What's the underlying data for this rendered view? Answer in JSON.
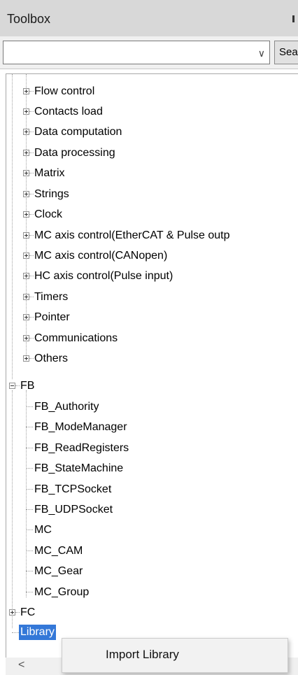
{
  "window": {
    "title": "Toolbox"
  },
  "search": {
    "value": "",
    "button_label": "Sea"
  },
  "tree": {
    "instruction_children": [
      "Flow control",
      "Contacts load",
      "Data computation",
      "Data processing",
      "Matrix",
      "Strings",
      "Clock",
      "MC axis control(EtherCAT & Pulse outp",
      "MC axis control(CANopen)",
      "HC axis control(Pulse input)",
      "Timers",
      "Pointer",
      "Communications",
      "Others"
    ],
    "fb": {
      "label": "FB",
      "children": [
        "FB_Authority",
        "FB_ModeManager",
        "FB_ReadRegisters",
        "FB_StateMachine",
        "FB_TCPSocket",
        "FB_UDPSocket",
        "MC",
        "MC_CAM",
        "MC_Gear",
        "MC_Group"
      ]
    },
    "fc": {
      "label": "FC"
    },
    "library": {
      "label": "Library"
    }
  },
  "context_menu": {
    "import_library": "Import Library"
  },
  "scrollbar": {
    "left_arrow": "<"
  }
}
